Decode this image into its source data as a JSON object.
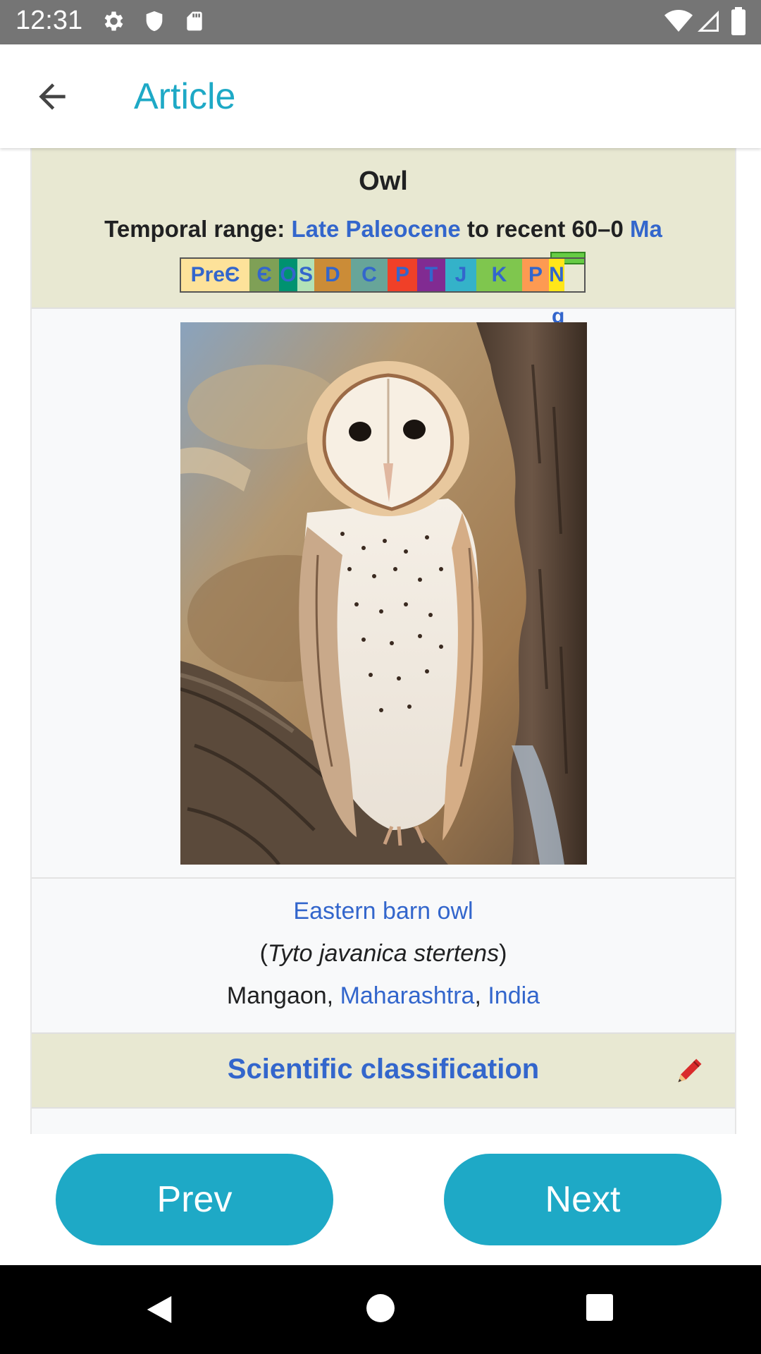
{
  "status_bar": {
    "time": "12:31",
    "left_icons": [
      "gear-icon",
      "shield-icon",
      "sd-card-icon"
    ],
    "right_icons": [
      "wifi-icon",
      "cell-signal-icon",
      "battery-icon"
    ]
  },
  "app_bar": {
    "title": "Article",
    "back_icon": "arrow-back-icon"
  },
  "infobox": {
    "title": "Owl",
    "temporal_label": "Temporal range:",
    "temporal_link1": "Late Paleocene",
    "temporal_mid": " to recent 60–0 ",
    "temporal_link2": "Ma",
    "timeline_segments": [
      {
        "label": "PreЄ",
        "color": "#fde29a"
      },
      {
        "label": "Є",
        "color": "#7fa056"
      },
      {
        "label": "O",
        "color": "#009270"
      },
      {
        "label": "S",
        "color": "#b3e1b6"
      },
      {
        "label": "D",
        "color": "#cb8c37"
      },
      {
        "label": "C",
        "color": "#67a599"
      },
      {
        "label": "P",
        "color": "#f04028"
      },
      {
        "label": "T",
        "color": "#812b92"
      },
      {
        "label": "J",
        "color": "#34b2c9"
      },
      {
        "label": "K",
        "color": "#7fc64e"
      },
      {
        "label": "P",
        "color": "#fd9a52"
      },
      {
        "label": "N",
        "color": "#ffe619"
      }
    ],
    "timeline_extra": "g",
    "caption_link": "Eastern barn owl",
    "caption_open": "(",
    "caption_sci": "Tyto javanica stertens",
    "caption_close": ")",
    "location_plain": "Mangaon, ",
    "location_link1": "Maharashtra",
    "location_sep": ", ",
    "location_link2": "India",
    "classification_label": "Scientific classification",
    "edit_icon": "pencil-icon"
  },
  "buttons": {
    "prev": "Prev",
    "next": "Next"
  },
  "nav_bar": {
    "icons": [
      "nav-back-icon",
      "nav-home-icon",
      "nav-recents-icon"
    ]
  },
  "colors": {
    "accent": "#1ea9c6",
    "link": "#3366cc",
    "infobox_header": "#e8e8d2"
  }
}
